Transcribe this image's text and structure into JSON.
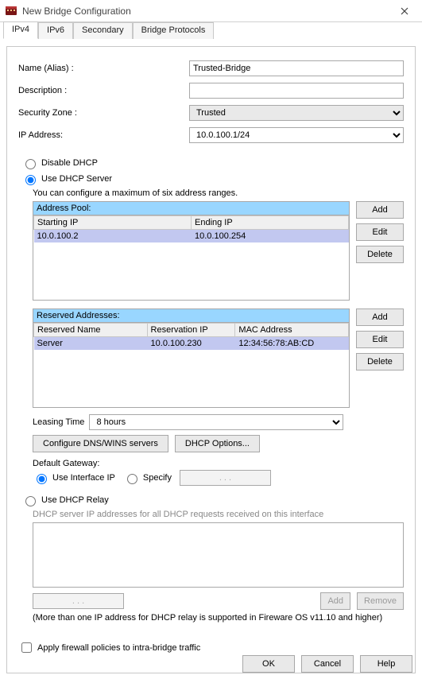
{
  "window": {
    "title": "New Bridge Configuration"
  },
  "tabs": {
    "ipv4": "IPv4",
    "ipv6": "IPv6",
    "secondary": "Secondary",
    "bridge_protocols": "Bridge Protocols"
  },
  "form": {
    "name_label": "Name (Alias) :",
    "name_value": "Trusted-Bridge",
    "desc_label": "Description :",
    "desc_value": "",
    "zone_label": "Security Zone :",
    "zone_value": "Trusted",
    "ip_label": "IP Address:",
    "ip_value": "10.0.100.1/24"
  },
  "dhcp": {
    "disable_label": "Disable DHCP",
    "server_label": "Use DHCP Server",
    "hint": "You can configure a maximum of six address ranges.",
    "pool_header": "Address Pool:",
    "pool_cols": {
      "start": "Starting IP",
      "end": "Ending IP"
    },
    "pool_row": {
      "start": "10.0.100.2",
      "end": "10.0.100.254"
    },
    "reserved_header": "Reserved Addresses:",
    "reserved_cols": {
      "name": "Reserved Name",
      "ip": "Reservation IP",
      "mac": "MAC Address"
    },
    "reserved_row": {
      "name": "Server",
      "ip": "10.0.100.230",
      "mac": "12:34:56:78:AB:CD"
    },
    "btn_add": "Add",
    "btn_edit": "Edit",
    "btn_delete": "Delete",
    "lease_label": "Leasing Time",
    "lease_value": "8 hours",
    "btn_dns": "Configure DNS/WINS servers",
    "btn_opts": "DHCP Options...",
    "gw_label": "Default Gateway:",
    "gw_use_ip": "Use Interface IP",
    "gw_specify": "Specify",
    "gw_ip_placeholder": ".        .        ."
  },
  "relay": {
    "label": "Use DHCP Relay",
    "hint": "DHCP server IP addresses for all DHCP requests received on this interface",
    "btn_add": "Add",
    "btn_remove": "Remove",
    "note": "(More than one IP address for DHCP relay is supported in Fireware OS v11.10 and higher)",
    "ip_placeholder": ".        .        ."
  },
  "apply_label": "Apply firewall policies to intra-bridge traffic",
  "footer": {
    "ok": "OK",
    "cancel": "Cancel",
    "help": "Help"
  }
}
